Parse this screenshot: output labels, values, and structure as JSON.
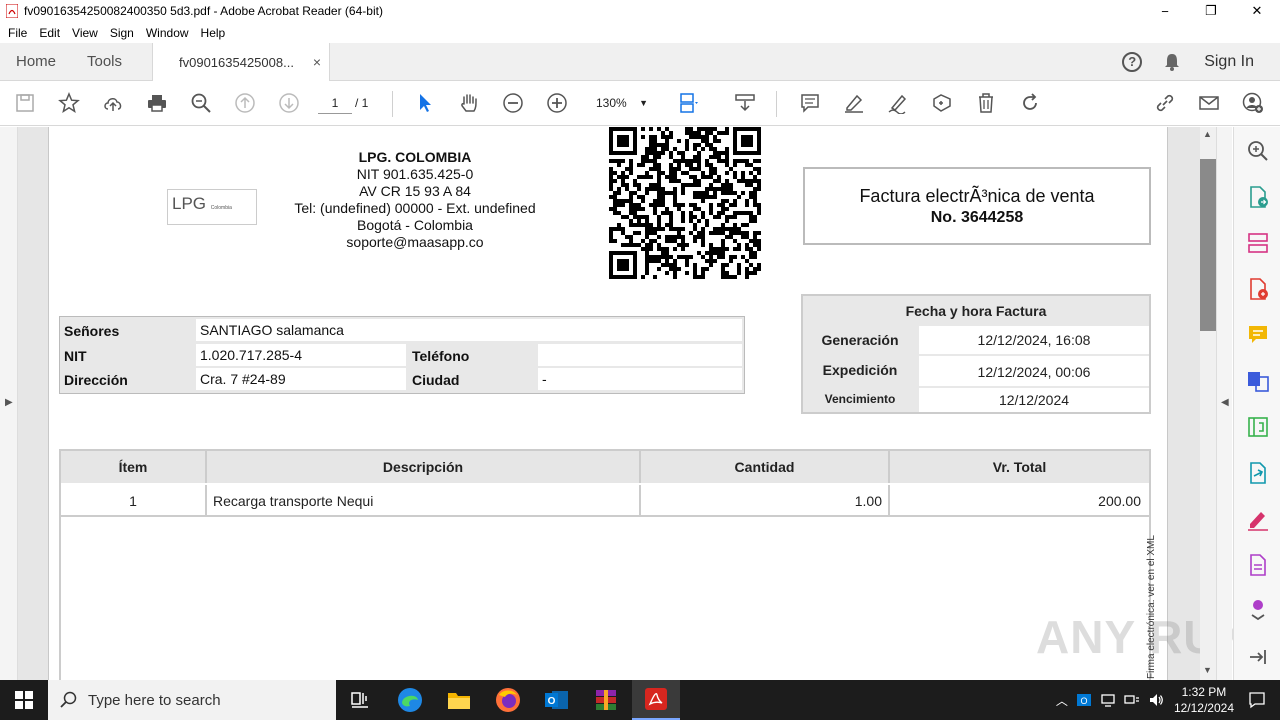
{
  "window": {
    "title": "fv09016354250082400350 5d3.pdf - Adobe Acrobat Reader (64-bit)",
    "minimize_glyph": "−",
    "restore_glyph": "❐",
    "close_glyph": "✕"
  },
  "menu": [
    "File",
    "Edit",
    "View",
    "Sign",
    "Window",
    "Help"
  ],
  "tabs": {
    "home": "Home",
    "tools": "Tools",
    "doc": "fv0901635425008...",
    "close_glyph": "×",
    "help_glyph": "?",
    "sign_in": "Sign In"
  },
  "toolbar": {
    "page_current": "1",
    "page_total": "/ 1",
    "zoom": "130%"
  },
  "invoice": {
    "logo_main": "LPG",
    "logo_sub": "Colombia",
    "company": {
      "name": "LPG. COLOMBIA",
      "nit": "NIT 901.635.425-0",
      "address": "AV CR 15 93 A 84",
      "tel": "Tel: (undefined) 00000 - Ext. undefined",
      "city": "Bogotá - Colombia",
      "email": "soporte@maasapp.co"
    },
    "doc_title": "Factura electrÃ³nica de venta",
    "doc_number": "No. 3644258",
    "client": {
      "senores_label": "Señores",
      "senores_value": "SANTIAGO salamanca",
      "nit_label": "NIT",
      "nit_value": "1.020.717.285-4",
      "telefono_label": "Teléfono",
      "telefono_value": "",
      "direccion_label": "Dirección",
      "direccion_value": "Cra. 7 #24-89",
      "ciudad_label": "Ciudad",
      "ciudad_value": "-"
    },
    "dates": {
      "header": "Fecha y hora Factura",
      "generacion_label": "Generación",
      "generacion_value": "12/12/2024, 16:08",
      "expedicion_label": "Expedición",
      "expedicion_value": "12/12/2024, 00:06",
      "vencimiento_label": "Vencimiento",
      "vencimiento_value": "12/12/2024"
    },
    "table": {
      "headers": [
        "Ítem",
        "Descripción",
        "Cantidad",
        "Vr. Total"
      ],
      "rows": [
        [
          "1",
          "Recarga transporte Nequi",
          "1.00",
          "200.00"
        ]
      ]
    },
    "side_note": "Firma electrónica: ver en el XML"
  },
  "watermark": "ANY RUN",
  "taskbar": {
    "search_placeholder": "Type here to search",
    "time": "1:32 PM",
    "date": "12/12/2024"
  },
  "colors": {
    "acrobat_red": "#d7261f",
    "accent_blue": "#1473e6",
    "taskbar": "#1c1c1c"
  }
}
